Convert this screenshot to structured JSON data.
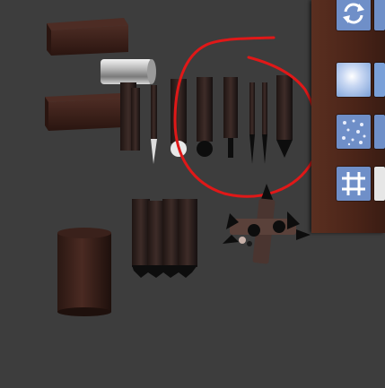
{
  "viewport": {
    "background": "#3d3d3d"
  },
  "annotation": {
    "color": "#e01818"
  },
  "toolbar": {
    "buttons": [
      {
        "name": "rotate-tool",
        "icon": "circular-arrows-icon",
        "color": "#6f8fc8"
      },
      {
        "name": "blur-tool",
        "icon": "soft-glow-icon",
        "color": "#7aa0d8"
      },
      {
        "name": "scatter-tool",
        "icon": "dots-pattern-icon",
        "color": "#6f8fc8"
      },
      {
        "name": "grid-tool",
        "icon": "hash-grid-icon",
        "color": "#6f8fc8"
      }
    ]
  },
  "objects": [
    "dark-beam-top",
    "metal-cylinder",
    "dark-beam-middle",
    "candle-stick-bundle",
    "pointed-spike-row",
    "spiked-stake-bundle",
    "spiked-cross-object",
    "dark-barrel-cylinder"
  ]
}
